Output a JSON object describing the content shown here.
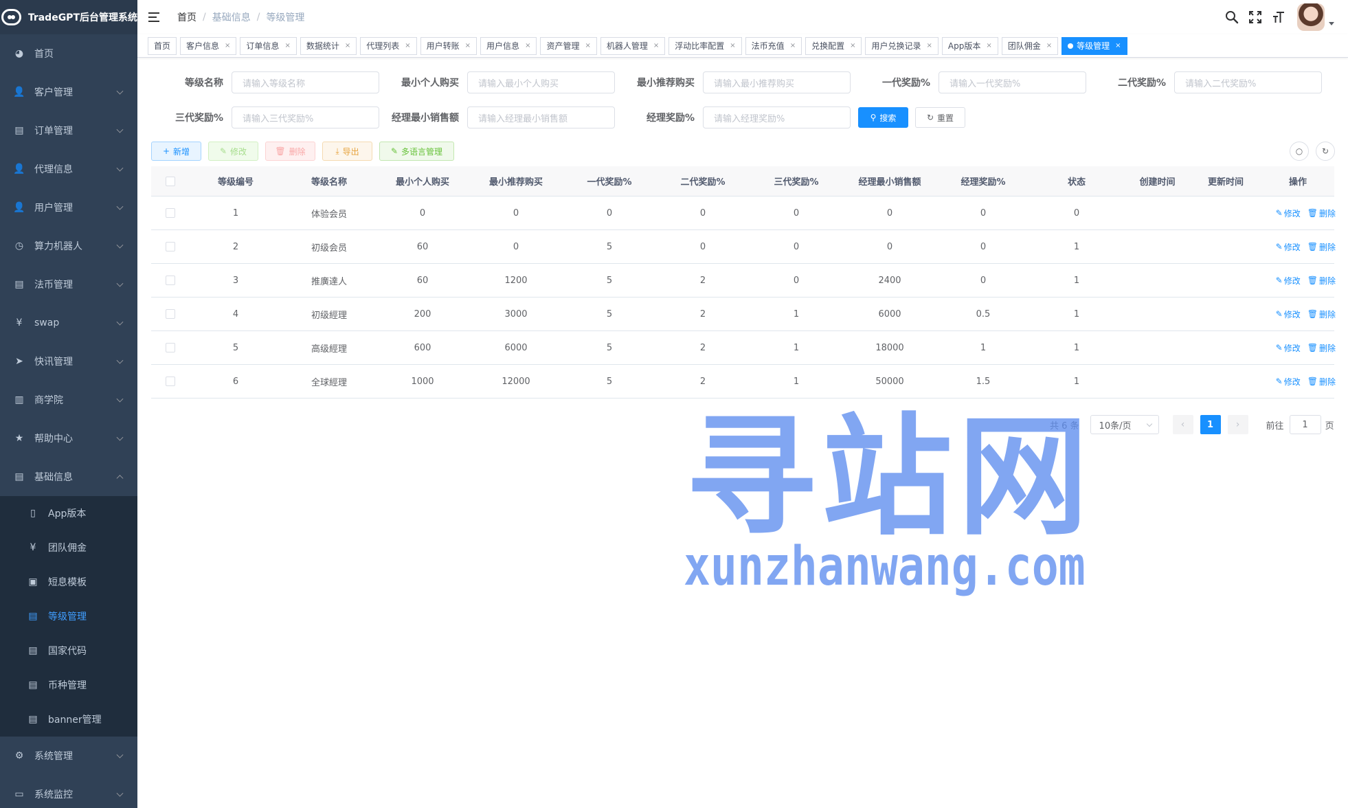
{
  "app": {
    "title": "TradeGPT后台管理系统"
  },
  "sidebar": {
    "items": [
      {
        "label": "首页",
        "icon": "dashboard-icon",
        "glyph": "◕",
        "expandable": false
      },
      {
        "label": "客户管理",
        "icon": "user-icon",
        "glyph": "👤",
        "expandable": true
      },
      {
        "label": "订单管理",
        "icon": "document-icon",
        "glyph": "▤",
        "expandable": true
      },
      {
        "label": "代理信息",
        "icon": "user-icon",
        "glyph": "👤",
        "expandable": true
      },
      {
        "label": "用户管理",
        "icon": "user-icon",
        "glyph": "👤",
        "expandable": true
      },
      {
        "label": "算力机器人",
        "icon": "clock-icon",
        "glyph": "◷",
        "expandable": true
      },
      {
        "label": "法币管理",
        "icon": "document-icon",
        "glyph": "▤",
        "expandable": true
      },
      {
        "label": "swap",
        "icon": "yen-icon",
        "glyph": "¥",
        "expandable": true
      },
      {
        "label": "快讯管理",
        "icon": "send-icon",
        "glyph": "➤",
        "expandable": true
      },
      {
        "label": "商学院",
        "icon": "book-icon",
        "glyph": "▥",
        "expandable": true
      },
      {
        "label": "帮助中心",
        "icon": "star-icon",
        "glyph": "★",
        "expandable": true
      },
      {
        "label": "基础信息",
        "icon": "document-icon",
        "glyph": "▤",
        "expandable": true,
        "open": true
      }
    ],
    "submenu": [
      {
        "label": "App版本",
        "icon": "phone-icon",
        "glyph": "▯",
        "active": false
      },
      {
        "label": "团队佣金",
        "icon": "yen-icon",
        "glyph": "¥",
        "active": false
      },
      {
        "label": "短息模板",
        "icon": "message-icon",
        "glyph": "▣",
        "active": false
      },
      {
        "label": "等级管理",
        "icon": "document-icon",
        "glyph": "▤",
        "active": true
      },
      {
        "label": "国家代码",
        "icon": "document-icon",
        "glyph": "▤",
        "active": false
      },
      {
        "label": "币种管理",
        "icon": "document-icon",
        "glyph": "▤",
        "active": false
      },
      {
        "label": "banner管理",
        "icon": "document-icon",
        "glyph": "▤",
        "active": false
      }
    ],
    "bottom": [
      {
        "label": "系统管理",
        "icon": "gear-icon",
        "glyph": "⚙",
        "expandable": true
      },
      {
        "label": "系统监控",
        "icon": "monitor-icon",
        "glyph": "▭",
        "expandable": true
      }
    ]
  },
  "navbar": {
    "breadcrumb": [
      "首页",
      "基础信息",
      "等级管理"
    ],
    "icons": [
      {
        "name": "search-icon",
        "glyph": "🔍"
      },
      {
        "name": "fullscreen-icon",
        "glyph": "⛶"
      },
      {
        "name": "font-size-icon",
        "glyph": "ㅜT"
      }
    ]
  },
  "tags": [
    {
      "label": "首页",
      "closable": false,
      "active": false
    },
    {
      "label": "客户信息",
      "closable": true,
      "active": false
    },
    {
      "label": "订单信息",
      "closable": true,
      "active": false
    },
    {
      "label": "数据统计",
      "closable": true,
      "active": false
    },
    {
      "label": "代理列表",
      "closable": true,
      "active": false
    },
    {
      "label": "用户转账",
      "closable": true,
      "active": false
    },
    {
      "label": "用户信息",
      "closable": true,
      "active": false
    },
    {
      "label": "资产管理",
      "closable": true,
      "active": false
    },
    {
      "label": "机器人管理",
      "closable": true,
      "active": false
    },
    {
      "label": "浮动比率配置",
      "closable": true,
      "active": false
    },
    {
      "label": "法币充值",
      "closable": true,
      "active": false
    },
    {
      "label": "兑换配置",
      "closable": true,
      "active": false
    },
    {
      "label": "用户兑换记录",
      "closable": true,
      "active": false
    },
    {
      "label": "App版本",
      "closable": true,
      "active": false
    },
    {
      "label": "团队佣金",
      "closable": true,
      "active": false
    },
    {
      "label": "等级管理",
      "closable": true,
      "active": true
    }
  ],
  "search": {
    "fields": [
      {
        "label": "等级名称",
        "placeholder": "请输入等级名称"
      },
      {
        "label": "最小个人购买",
        "placeholder": "请输入最小个人购买"
      },
      {
        "label": "最小推荐购买",
        "placeholder": "请输入最小推荐购买"
      },
      {
        "label": "一代奖励%",
        "placeholder": "请输入一代奖励%"
      },
      {
        "label": "二代奖励%",
        "placeholder": "请输入二代奖励%"
      },
      {
        "label": "三代奖励%",
        "placeholder": "请输入三代奖励%"
      },
      {
        "label": "经理最小销售额",
        "placeholder": "请输入经理最小销售额"
      },
      {
        "label": "经理奖励%",
        "placeholder": "请输入经理奖励%"
      }
    ],
    "search_label": "搜索",
    "reset_label": "重置"
  },
  "toolbar": {
    "add_label": "新增",
    "edit_label": "修改",
    "delete_label": "删除",
    "export_label": "导出",
    "i18n_label": "多语言管理"
  },
  "table": {
    "columns": [
      "等级编号",
      "等级名称",
      "最小个人购买",
      "最小推荐购买",
      "一代奖励%",
      "二代奖励%",
      "三代奖励%",
      "经理最小销售额",
      "经理奖励%",
      "状态",
      "创建时间",
      "更新时间",
      "操作"
    ],
    "rows": [
      [
        "1",
        "体验会员",
        "0",
        "0",
        "0",
        "0",
        "0",
        "0",
        "0",
        "0",
        "",
        ""
      ],
      [
        "2",
        "初级会员",
        "60",
        "0",
        "5",
        "0",
        "0",
        "0",
        "0",
        "1",
        "",
        ""
      ],
      [
        "3",
        "推廣達人",
        "60",
        "1200",
        "5",
        "2",
        "0",
        "2400",
        "0",
        "1",
        "",
        ""
      ],
      [
        "4",
        "初级經理",
        "200",
        "3000",
        "5",
        "2",
        "1",
        "6000",
        "0.5",
        "1",
        "",
        ""
      ],
      [
        "5",
        "高级經理",
        "600",
        "6000",
        "5",
        "2",
        "1",
        "18000",
        "1",
        "1",
        "",
        ""
      ],
      [
        "6",
        "全球經理",
        "1000",
        "12000",
        "5",
        "2",
        "1",
        "50000",
        "1.5",
        "1",
        "",
        ""
      ]
    ],
    "row_edit_label": "修改",
    "row_delete_label": "删除"
  },
  "pagination": {
    "total_text": "共 6 条",
    "page_size": "10条/页",
    "current_page": "1",
    "goto_label": "前往",
    "goto_value": "1",
    "page_unit": "页"
  },
  "watermark": {
    "cn": "寻站网",
    "en": "xunzhanwang.com"
  },
  "colors": {
    "primary": "#1890ff",
    "sidebar_bg": "#304156",
    "submenu_bg": "#1f2d3d",
    "active_menu": "#409eff"
  }
}
